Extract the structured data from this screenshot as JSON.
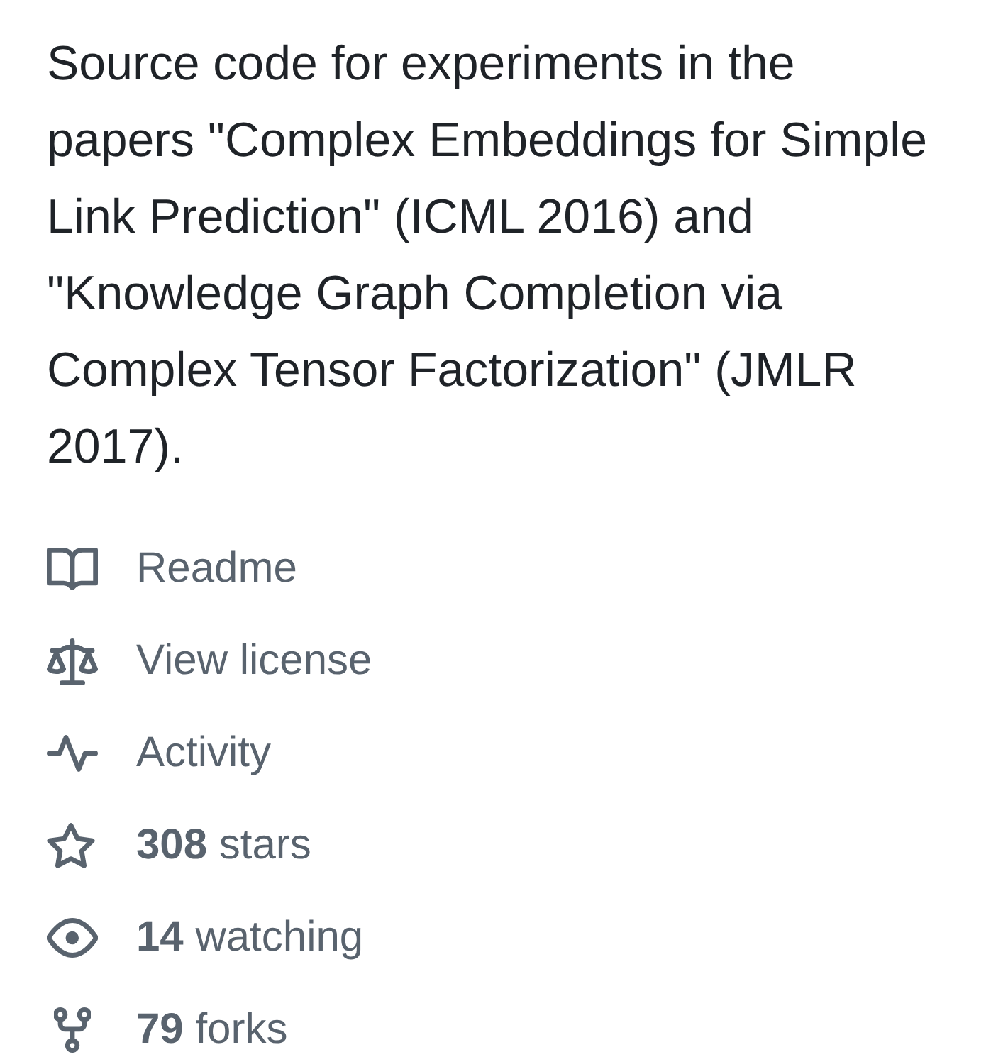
{
  "description": "Source code for experiments in the papers \"Complex Embeddings for Simple Link Prediction\" (ICML 2016) and \"Knowledge Graph Completion via Complex Tensor Factorization\" (JMLR 2017).",
  "links": [
    {
      "kind": "readme",
      "label": "Readme"
    },
    {
      "kind": "license",
      "label": "View license"
    },
    {
      "kind": "activity",
      "label": "Activity"
    },
    {
      "kind": "stars",
      "label": "**308** stars"
    },
    {
      "kind": "watching",
      "label": "**14** watching"
    },
    {
      "kind": "forks",
      "label": "**79** forks"
    }
  ]
}
